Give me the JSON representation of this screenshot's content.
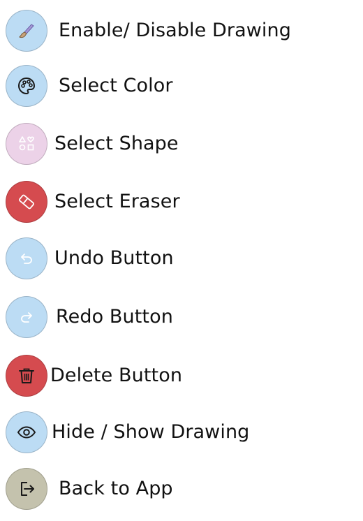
{
  "menu": {
    "items": [
      {
        "label": "Enable/ Disable Drawing",
        "icon": "brush-icon",
        "color": "#bcdcf4"
      },
      {
        "label": "Select Color",
        "icon": "palette-icon",
        "color": "#bcdcf4"
      },
      {
        "label": "Select Shape",
        "icon": "shapes-icon",
        "color": "#ecd2e8"
      },
      {
        "label": "Select Eraser",
        "icon": "eraser-icon",
        "color": "#d54b4f"
      },
      {
        "label": "Undo Button",
        "icon": "undo-icon",
        "color": "#bcdcf4"
      },
      {
        "label": "Redo Button",
        "icon": "redo-icon",
        "color": "#bcdcf4"
      },
      {
        "label": "Delete Button",
        "icon": "trash-icon",
        "color": "#d54b4f"
      },
      {
        "label": "Hide / Show Drawing",
        "icon": "eye-icon",
        "color": "#bcdcf4"
      },
      {
        "label": "Back to App",
        "icon": "exit-icon",
        "color": "#c4c2ad"
      }
    ]
  }
}
